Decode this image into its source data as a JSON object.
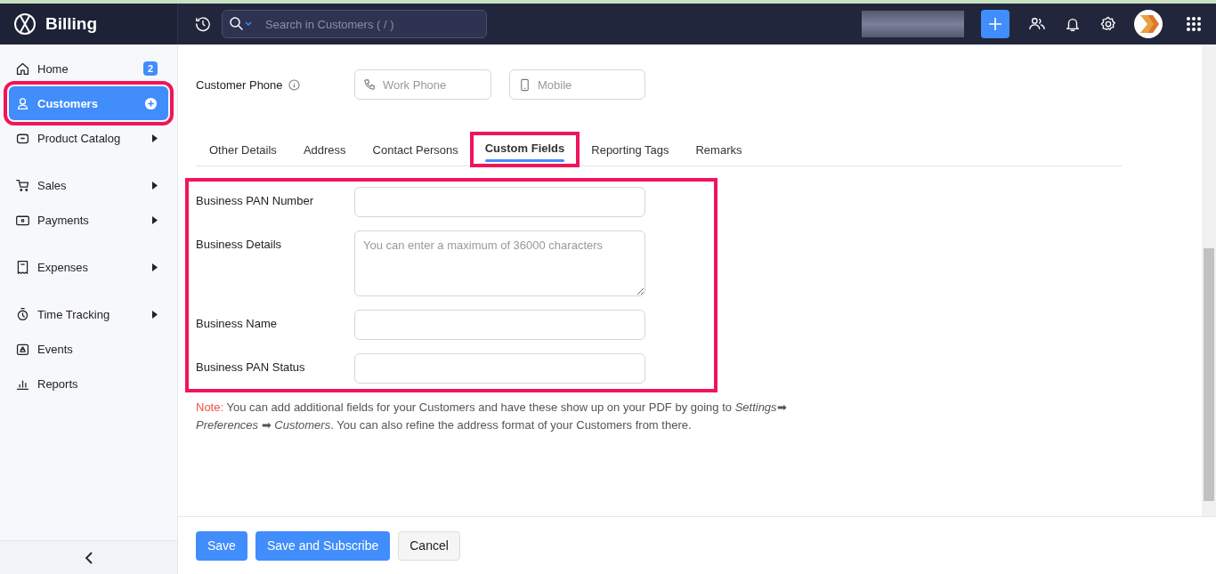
{
  "header": {
    "app_name": "Billing",
    "search": {
      "placeholder": "Search in Customers ( / )"
    }
  },
  "sidebar": {
    "items": [
      {
        "label": "Home",
        "badge": "2",
        "selected": false,
        "expandable": false,
        "highlighted": false
      },
      {
        "label": "Customers",
        "selected": true,
        "expandable": false,
        "highlighted": true
      },
      {
        "label": "Product Catalog",
        "selected": false,
        "expandable": true,
        "highlighted": false
      },
      {
        "label": "Sales",
        "selected": false,
        "expandable": true,
        "highlighted": false
      },
      {
        "label": "Payments",
        "selected": false,
        "expandable": true,
        "highlighted": false
      },
      {
        "label": "Expenses",
        "selected": false,
        "expandable": true,
        "highlighted": false
      },
      {
        "label": "Time Tracking",
        "selected": false,
        "expandable": true,
        "highlighted": false
      },
      {
        "label": "Events",
        "selected": false,
        "expandable": false,
        "highlighted": false
      },
      {
        "label": "Reports",
        "selected": false,
        "expandable": false,
        "highlighted": false
      }
    ]
  },
  "phone": {
    "label": "Customer Phone",
    "fields": [
      {
        "placeholder": "Work Phone"
      },
      {
        "placeholder": "Mobile"
      }
    ]
  },
  "tabs": [
    {
      "label": "Other Details",
      "selected": false,
      "highlighted": false
    },
    {
      "label": "Address",
      "selected": false,
      "highlighted": false
    },
    {
      "label": "Contact Persons",
      "selected": false,
      "highlighted": false
    },
    {
      "label": "Custom Fields",
      "selected": true,
      "highlighted": true
    },
    {
      "label": "Reporting Tags",
      "selected": false,
      "highlighted": false
    },
    {
      "label": "Remarks",
      "selected": false,
      "highlighted": false
    }
  ],
  "custom_fields": {
    "highlighted": true,
    "fields": [
      {
        "label": "Business PAN Number",
        "kind": "text"
      },
      {
        "label": "Business Details",
        "kind": "textarea",
        "placeholder": "You can enter a maximum of 36000 characters"
      },
      {
        "label": "Business Name",
        "kind": "text"
      },
      {
        "label": "Business PAN Status",
        "kind": "text"
      }
    ]
  },
  "note": {
    "prefix": "Note:",
    "text": "You can add additional fields for your Customers and have these show up on your PDF by going to *Settings*➡ *Preferences* ➡ *Customers*. You can also refine the address format of your Customers from there."
  },
  "buttons": [
    {
      "label": "Save",
      "kind": "primary"
    },
    {
      "label": "Save and Subscribe",
      "kind": "primary"
    },
    {
      "label": "Cancel",
      "kind": "secondary"
    }
  ]
}
